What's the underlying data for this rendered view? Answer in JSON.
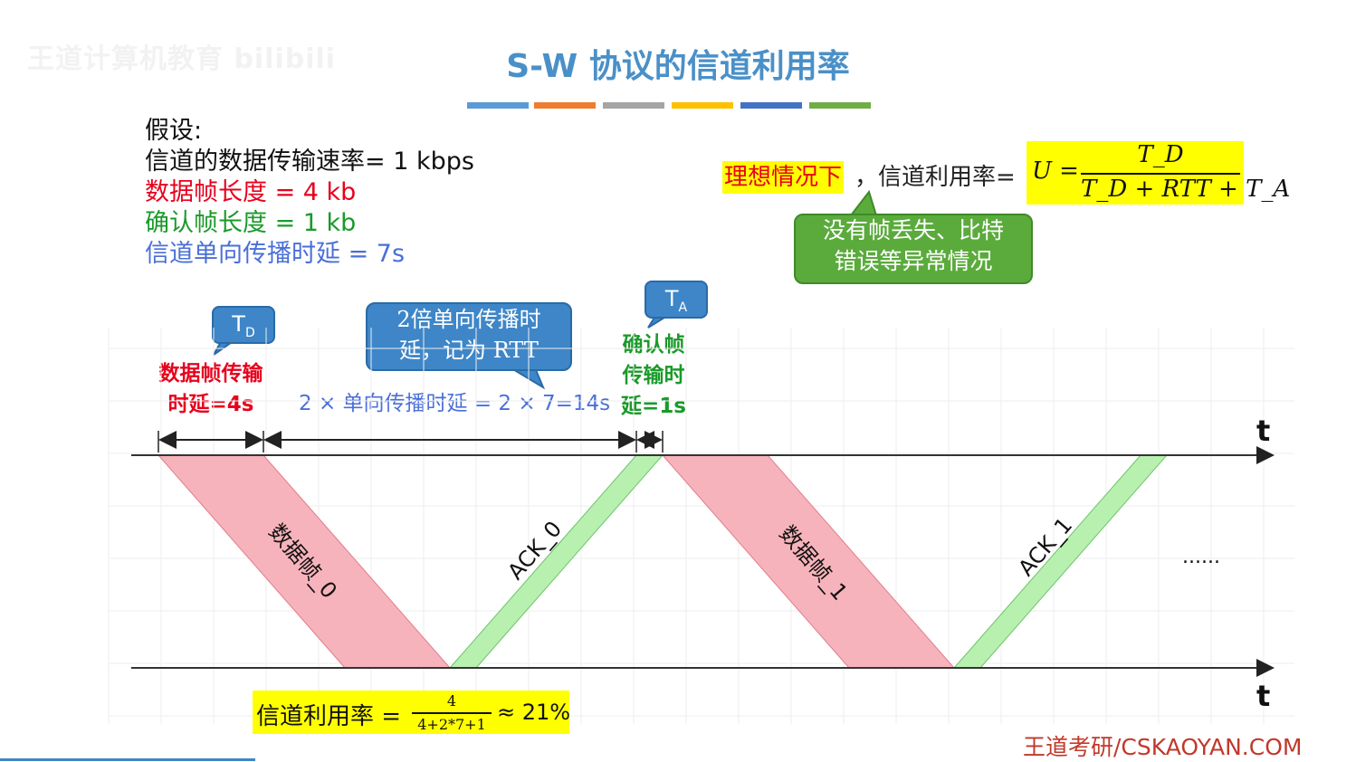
{
  "watermark": "王道计算机教育 bilibili",
  "title": "S-W 协议的信道利用率",
  "title_bar_colors": [
    "#5b9bd5",
    "#ed7d31",
    "#a5a5a5",
    "#ffc000",
    "#4472c4",
    "#70ad47"
  ],
  "assumptions": {
    "heading": "假设:",
    "rate": "信道的数据传输速率= 1 kbps",
    "data_frame": "数据帧长度 = 4 kb",
    "ack_frame": "确认帧长度 = 1 kb",
    "propagation": "信道单向传播时延 = 7s"
  },
  "ideal": {
    "label": "理想情况下",
    "text": "，信道利用率=",
    "formula_lhs": "U =",
    "formula_num": "T_D",
    "formula_den": "T_D + RTT + T_A"
  },
  "green_callout": {
    "line1": "没有帧丢失、比特",
    "line2": "错误等异常情况"
  },
  "td_bubble": "T",
  "td_sub": "D",
  "ta_bubble": "T",
  "ta_sub": "A",
  "blue_callout": {
    "line1": "2倍单向传播时",
    "line2": "延，记为 RTT"
  },
  "labels": {
    "td_line1": "数据帧传输",
    "td_line2": "时延=4s",
    "rtt": "2 × 单向传播时延 = 2 × 7=14s",
    "ta_line1": "确认帧",
    "ta_line2": "传输时",
    "ta_line3": "延=1s"
  },
  "diagram": {
    "axis_label_top": "t",
    "axis_label_bottom": "t",
    "frame0": "数据帧_0",
    "ack0": "ACK_0",
    "frame1": "数据帧_1",
    "ack1": "ACK_1",
    "ellipsis": "......",
    "colors": {
      "data": "#f7b3bb",
      "ack": "#b8f0b0",
      "data_stroke": "#e07d8a",
      "ack_stroke": "#6cc46a"
    }
  },
  "utilization": {
    "text": "信道利用率 =",
    "numerator": "4",
    "denominator": "4+2*7+1",
    "result": "≈ 21%"
  },
  "footer": "王道考研/CSKAOYAN.COM"
}
